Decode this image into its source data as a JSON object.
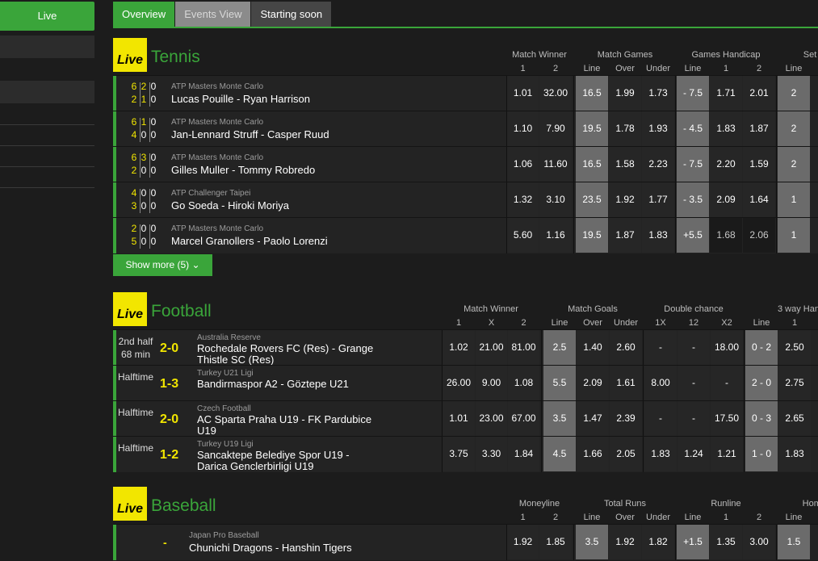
{
  "sidebar": {
    "live_label": "Live"
  },
  "tabs": [
    {
      "label": "Overview"
    },
    {
      "label": "Events View"
    },
    {
      "label": "Starting soon"
    }
  ],
  "badge": "Live",
  "tennis": {
    "title": "Tennis",
    "headers": {
      "mw": "Match Winner",
      "mg": "Match Games",
      "gh": "Games Handicap",
      "set": "Set"
    },
    "sub": {
      "mw1": "1",
      "mw2": "2",
      "mgl": "Line",
      "mgo": "Over",
      "mgu": "Under",
      "ghl": "Line",
      "gh1": "1",
      "gh2": "2",
      "setl": "Line"
    },
    "rows": [
      {
        "s1": [
          "6",
          "2",
          "0"
        ],
        "s2": [
          "2",
          "1",
          "0"
        ],
        "league": "ATP Masters Monte Carlo",
        "teams": "Lucas Pouille - Ryan Harrison",
        "odds": [
          "1.01",
          "32.00",
          "16.5",
          "1.99",
          "1.73",
          "- 7.5",
          "1.71",
          "2.01",
          "2"
        ]
      },
      {
        "s1": [
          "6",
          "1",
          "0"
        ],
        "s2": [
          "4",
          "0",
          "0"
        ],
        "league": "ATP Masters Monte Carlo",
        "teams": "Jan-Lennard Struff - Casper Ruud",
        "odds": [
          "1.10",
          "7.90",
          "19.5",
          "1.78",
          "1.93",
          "- 4.5",
          "1.83",
          "1.87",
          "2"
        ]
      },
      {
        "s1": [
          "6",
          "3",
          "0"
        ],
        "s2": [
          "2",
          "0",
          "0"
        ],
        "league": "ATP Masters Monte Carlo",
        "teams": "Gilles Muller - Tommy Robredo",
        "odds": [
          "1.06",
          "11.60",
          "16.5",
          "1.58",
          "2.23",
          "- 7.5",
          "2.20",
          "1.59",
          "2"
        ]
      },
      {
        "s1": [
          "4",
          "0",
          "0"
        ],
        "s2": [
          "3",
          "0",
          "0"
        ],
        "league": "ATP Challenger Taipei",
        "teams": "Go Soeda - Hiroki Moriya",
        "odds": [
          "1.32",
          "3.10",
          "23.5",
          "1.92",
          "1.77",
          "- 3.5",
          "2.09",
          "1.64",
          "1"
        ]
      },
      {
        "s1": [
          "2",
          "0",
          "0"
        ],
        "s2": [
          "5",
          "0",
          "0"
        ],
        "league": "ATP Masters Monte Carlo",
        "teams": "Marcel Granollers - Paolo Lorenzi",
        "odds": [
          "5.60",
          "1.16",
          "19.5",
          "1.87",
          "1.83",
          "+5.5",
          "1.68",
          "2.06",
          "1"
        ]
      }
    ],
    "show_more": "Show more (5)"
  },
  "football": {
    "title": "Football",
    "headers": {
      "mw": "Match Winner",
      "mg": "Match Goals",
      "dc": "Double chance",
      "wh": "3 way Han"
    },
    "sub": {
      "mw1": "1",
      "mwx": "X",
      "mw2": "2",
      "mgl": "Line",
      "mgo": "Over",
      "mgu": "Under",
      "dc1": "1X",
      "dc2": "12",
      "dc3": "X2",
      "whl": "Line",
      "wh1": "1"
    },
    "rows": [
      {
        "status": "2nd half\n68 min",
        "score": "2-0",
        "league": "Australia Reserve",
        "teams": "Rochedale Rovers FC (Res) - Grange Thistle SC (Res)",
        "odds": [
          "1.02",
          "21.00",
          "81.00",
          "2.5",
          "1.40",
          "2.60",
          "-",
          "-",
          "18.00",
          "0 - 2",
          "2.50"
        ]
      },
      {
        "status": "Halftime",
        "score": "1-3",
        "league": "Turkey U21 Ligi",
        "teams": "Bandirmaspor A2 - Göztepe U21",
        "odds": [
          "26.00",
          "9.00",
          "1.08",
          "5.5",
          "2.09",
          "1.61",
          "8.00",
          "-",
          "-",
          "2 - 0",
          "2.75"
        ]
      },
      {
        "status": "Halftime",
        "score": "2-0",
        "league": "Czech Football",
        "teams": "AC Sparta Praha U19 - FK Pardubice U19",
        "odds": [
          "1.01",
          "23.00",
          "67.00",
          "3.5",
          "1.47",
          "2.39",
          "-",
          "-",
          "17.50",
          "0 - 3",
          "2.65"
        ]
      },
      {
        "status": "Halftime",
        "score": "1-2",
        "league": "Turkey U19 Ligi",
        "teams": "Sancaktepe Belediye Spor U19 - Darica Genclerbirligi U19",
        "odds": [
          "3.75",
          "3.30",
          "1.84",
          "4.5",
          "1.66",
          "2.05",
          "1.83",
          "1.24",
          "1.21",
          "1 - 0",
          "1.83"
        ]
      }
    ]
  },
  "baseball": {
    "title": "Baseball",
    "headers": {
      "ml": "Moneyline",
      "tr": "Total Runs",
      "rl": "Runline",
      "home": "Home"
    },
    "sub": {
      "ml1": "1",
      "ml2": "2",
      "trl": "Line",
      "tro": "Over",
      "tru": "Under",
      "rll": "Line",
      "rl1": "1",
      "rl2": "2",
      "hl": "Line"
    },
    "rows": [
      {
        "score": "-",
        "league": "Japan Pro Baseball",
        "teams": "Chunichi Dragons - Hanshin Tigers",
        "odds": [
          "1.92",
          "1.85",
          "3.5",
          "1.92",
          "1.82",
          "+1.5",
          "1.35",
          "3.00",
          "1.5"
        ]
      }
    ]
  }
}
